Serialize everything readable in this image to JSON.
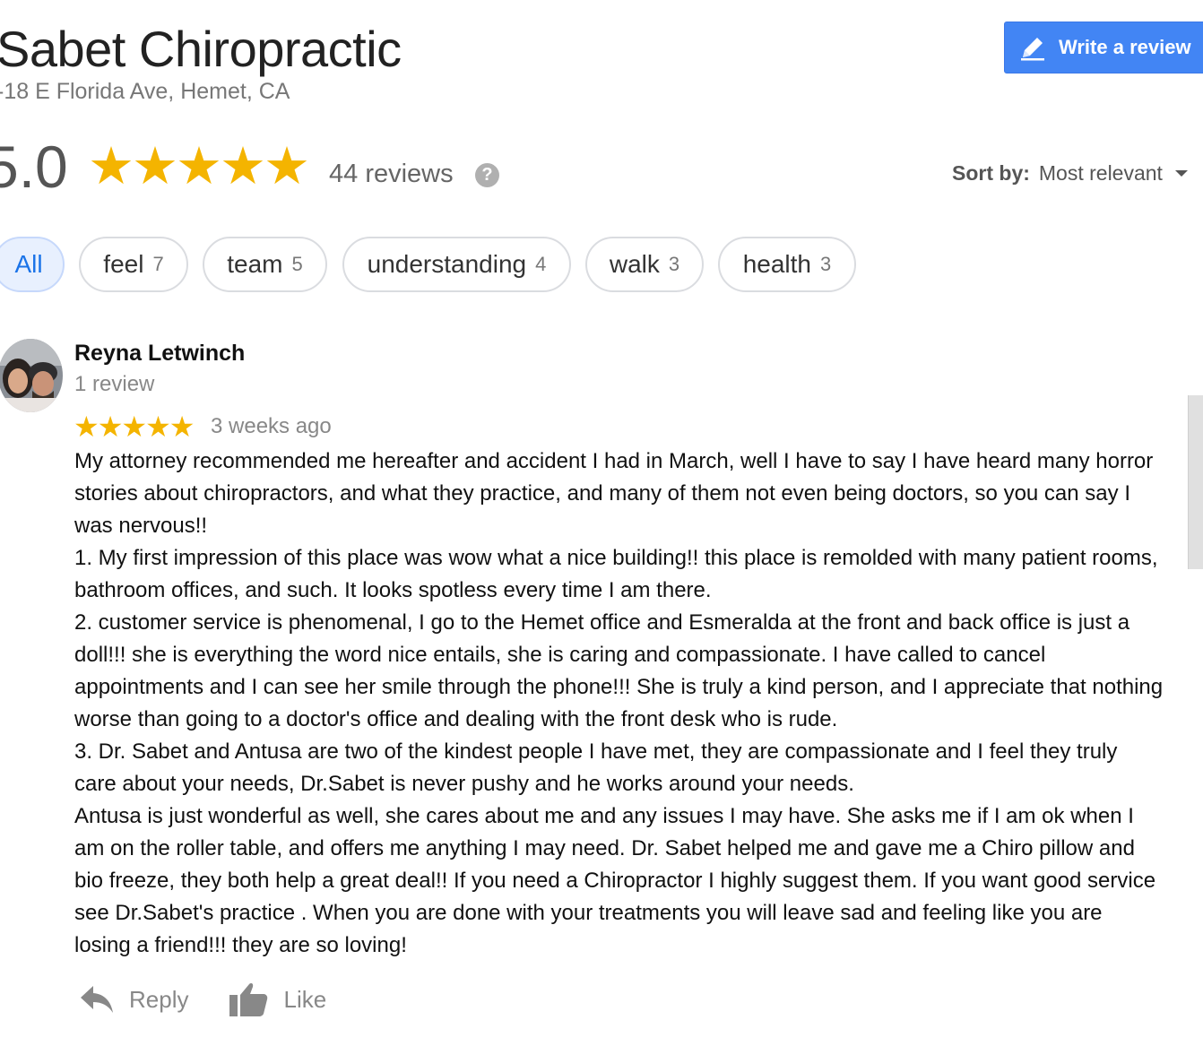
{
  "business": {
    "name": "Sabet Chiropractic",
    "address": "-18 E Florida Ave, Hemet, CA"
  },
  "write_review": {
    "label": "Write a review",
    "icon": "pencil-icon",
    "color": "#4285f4"
  },
  "summary": {
    "rating": "5.0",
    "stars": "★★★★★",
    "star_value": 5,
    "star_color": "#f4b400",
    "review_count": "44 reviews",
    "help_icon": "?"
  },
  "sort": {
    "label": "Sort by:",
    "value": "Most relevant"
  },
  "filters": [
    {
      "label": "All",
      "count": ""
    },
    {
      "label": "feel",
      "count": "7"
    },
    {
      "label": "team",
      "count": "5"
    },
    {
      "label": "understanding",
      "count": "4"
    },
    {
      "label": "walk",
      "count": "3"
    },
    {
      "label": "health",
      "count": "3"
    }
  ],
  "review": {
    "author": "Reyna Letwinch",
    "author_review_count": "1 review",
    "stars": "★★★★★",
    "star_value": 5,
    "date": "3 weeks ago",
    "paragraphs": [
      "My attorney recommended me hereafter and accident I had in March, well I have to say I have heard many horror stories about chiropractors, and what they practice, and many of them not even being doctors, so you can say I was nervous!!",
      "1. My first impression of this place was wow what a nice building!! this place is remolded with many patient rooms, bathroom offices, and such. It looks spotless every time I am there.",
      "2. customer service is phenomenal, I go to the Hemet office and Esmeralda at the front and back office is just a doll!!! she is everything the word nice entails, she is caring and compassionate. I have called to cancel appointments and I can see her smile through the phone!!! She is truly a kind person, and I appreciate that nothing worse than going to a doctor's office and dealing with the front desk who is rude.",
      "3. Dr. Sabet and Antusa are two of the kindest people I have met, they are compassionate and I feel they truly care about your needs, Dr.Sabet is never pushy and he works around your needs.",
      "Antusa is just wonderful as well, she cares about me and any issues I may have. She asks me if I am ok when I am on the roller table, and offers me anything I may need. Dr. Sabet helped me and gave me a Chiro pillow and bio freeze, they both help a great deal!! If you need a Chiropractor I highly suggest them. If you want good service see Dr.Sabet's practice . When you are done with your treatments you will leave sad and feeling like you are losing a friend!!! they are so loving!"
    ],
    "actions": {
      "reply": "Reply",
      "like": "Like"
    }
  }
}
